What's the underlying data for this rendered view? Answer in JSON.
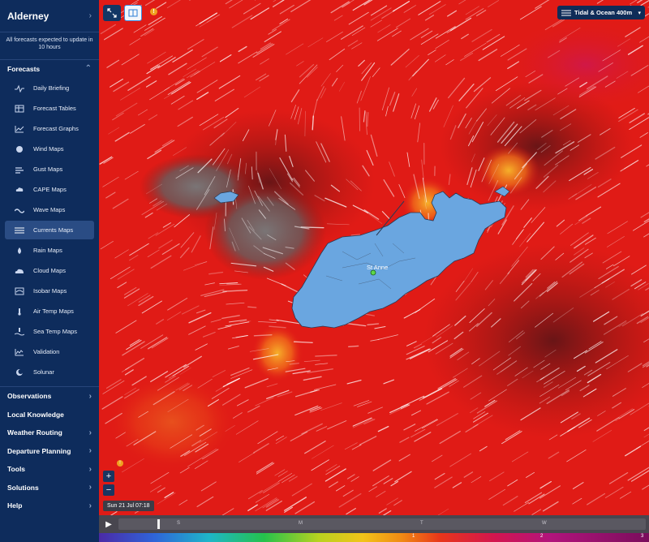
{
  "sidebar": {
    "title": "Alderney",
    "note": "All forecasts expected to update in 10 hours",
    "forecasts_label": "Forecasts",
    "items": [
      {
        "label": "Daily Briefing",
        "icon": "pulse-icon"
      },
      {
        "label": "Forecast Tables",
        "icon": "table-icon"
      },
      {
        "label": "Forecast Graphs",
        "icon": "graph-icon"
      },
      {
        "label": "Wind Maps",
        "icon": "wind-dial-icon"
      },
      {
        "label": "Gust Maps",
        "icon": "gust-icon"
      },
      {
        "label": "CAPE Maps",
        "icon": "cape-cloud-icon"
      },
      {
        "label": "Wave Maps",
        "icon": "wave-icon"
      },
      {
        "label": "Currents Maps",
        "icon": "currents-icon"
      },
      {
        "label": "Rain Maps",
        "icon": "rain-drop-icon"
      },
      {
        "label": "Cloud Maps",
        "icon": "cloud-icon"
      },
      {
        "label": "Isobar Maps",
        "icon": "isobar-icon"
      },
      {
        "label": "Air Temp Maps",
        "icon": "thermometer-icon"
      },
      {
        "label": "Sea Temp Maps",
        "icon": "sea-temp-icon"
      },
      {
        "label": "Validation",
        "icon": "validation-chart-icon"
      },
      {
        "label": "Solunar",
        "icon": "solunar-icon"
      }
    ],
    "active_item": "Currents Maps",
    "bottom_sections": [
      "Observations",
      "Local Knowledge",
      "Weather Routing",
      "Departure Planning",
      "Tools",
      "Solutions",
      "Help"
    ]
  },
  "map": {
    "layer_label": "Tidal & Ocean 400m",
    "place_label": "St Anne",
    "time_label": "Sun 21 Jul 07:18",
    "timeline_ticks": [
      "S",
      "M",
      "T",
      "W"
    ],
    "legend_values": [
      "1",
      "2",
      "3"
    ],
    "zoom_in": "+",
    "zoom_out": "−",
    "info_badge": "!",
    "warn_badge": "!"
  },
  "colors": {
    "sidebar_bg": "#0e2c5c",
    "active_item_bg": "#2a4c84",
    "current_field_red": "#e01b16",
    "land": "#6aa6e0"
  }
}
